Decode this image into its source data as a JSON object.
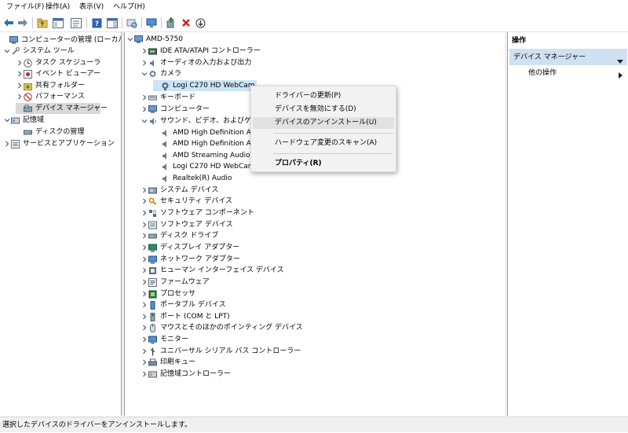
{
  "menubar": {
    "items": [
      "ファイル(F)",
      "操作(A)",
      "表示(V)",
      "ヘルプ(H)"
    ]
  },
  "toolbar": {
    "buttons": [
      "back-arrow-icon",
      "forward-arrow-icon",
      "up-folder-icon",
      "console-tree-icon",
      "properties-icon",
      "help-icon",
      "action-pane-icon",
      "scan-hardware-icon",
      "computer-display-icon",
      "update-driver-icon",
      "delete-x-icon",
      "disable-down-icon"
    ]
  },
  "left_tree": {
    "items": [
      {
        "label": "コンピューターの管理 (ローカル)",
        "icon": "computer-management-icon"
      },
      {
        "label": "システム ツール",
        "icon": "tools-icon"
      },
      {
        "label": "タスク スケジューラ",
        "icon": "clock-icon"
      },
      {
        "label": "イベント ビューアー",
        "icon": "event-viewer-icon"
      },
      {
        "label": "共有フォルダー",
        "icon": "shared-folder-icon"
      },
      {
        "label": "パフォーマンス",
        "icon": "performance-icon"
      },
      {
        "label": "デバイス マネージャー",
        "icon": "device-manager-icon"
      },
      {
        "label": "記憶域",
        "icon": "storage-icon"
      },
      {
        "label": "ディスクの管理",
        "icon": "disk-icon"
      },
      {
        "label": "サービスとアプリケーション",
        "icon": "services-icon"
      }
    ]
  },
  "device_tree": {
    "root": "AMD-5750",
    "items": [
      {
        "label": "IDE ATA/ATAPI コントローラー",
        "icon": "ide-controller-icon"
      },
      {
        "label": "オーディオの入力および出力",
        "icon": "speaker-icon"
      },
      {
        "label": "カメラ",
        "icon": "camera-icon"
      },
      {
        "label": "Logi C270 HD WebCam",
        "icon": "webcam-icon"
      },
      {
        "label": "キーボード",
        "icon": "keyboard-icon"
      },
      {
        "label": "コンピューター",
        "icon": "computer-icon"
      },
      {
        "label": "サウンド、ビデオ、およびゲーム コントローラー",
        "icon": "sound-icon"
      },
      {
        "label": "AMD High Definition Audio Device",
        "icon": "audio-device-icon"
      },
      {
        "label": "AMD High Definition Audio Device",
        "icon": "audio-device-icon"
      },
      {
        "label": "AMD Streaming Audio Device",
        "icon": "audio-device-icon"
      },
      {
        "label": "Logi C270 HD WebCam",
        "icon": "audio-device-icon"
      },
      {
        "label": "Realtek(R) Audio",
        "icon": "audio-device-icon"
      },
      {
        "label": "システム デバイス",
        "icon": "system-device-icon"
      },
      {
        "label": "セキュリティ デバイス",
        "icon": "security-key-icon"
      },
      {
        "label": "ソフトウェア コンポーネント",
        "icon": "software-component-icon"
      },
      {
        "label": "ソフトウェア デバイス",
        "icon": "software-device-icon"
      },
      {
        "label": "ディスク ドライブ",
        "icon": "disk-drive-icon"
      },
      {
        "label": "ディスプレイ アダプター",
        "icon": "display-adapter-icon"
      },
      {
        "label": "ネットワーク アダプター",
        "icon": "network-adapter-icon"
      },
      {
        "label": "ヒューマン インターフェイス デバイス",
        "icon": "hid-icon"
      },
      {
        "label": "ファームウェア",
        "icon": "firmware-icon"
      },
      {
        "label": "プロセッサ",
        "icon": "processor-icon"
      },
      {
        "label": "ポータブル デバイス",
        "icon": "portable-device-icon"
      },
      {
        "label": "ポート (COM と LPT)",
        "icon": "port-icon"
      },
      {
        "label": "マウスとそのほかのポインティング デバイス",
        "icon": "mouse-icon"
      },
      {
        "label": "モニター",
        "icon": "monitor-icon"
      },
      {
        "label": "ユニバーサル シリアル バス コントローラー",
        "icon": "usb-icon"
      },
      {
        "label": "印刷キュー",
        "icon": "printer-icon"
      },
      {
        "label": "記憶域コントローラー",
        "icon": "storage-controller-icon"
      }
    ]
  },
  "context_menu": {
    "items": [
      "ドライバーの更新(P)",
      "デバイスを無効にする(D)",
      "デバイスのアンインストール(U)",
      "ハードウェア変更のスキャン(A)",
      "プロパティ(R)"
    ]
  },
  "action_pane": {
    "header": "操作",
    "section": "デバイス マネージャー",
    "more_actions": "他の操作"
  },
  "statusbar": {
    "text": "選択したデバイスのドライバーをアンインストールします。"
  },
  "colors": {
    "selection": "#d9d9d9",
    "action_section": "#cfe0f2",
    "accent_blue": "#2f6db5",
    "red_x": "#d22020",
    "green": "#2e8b3a"
  }
}
